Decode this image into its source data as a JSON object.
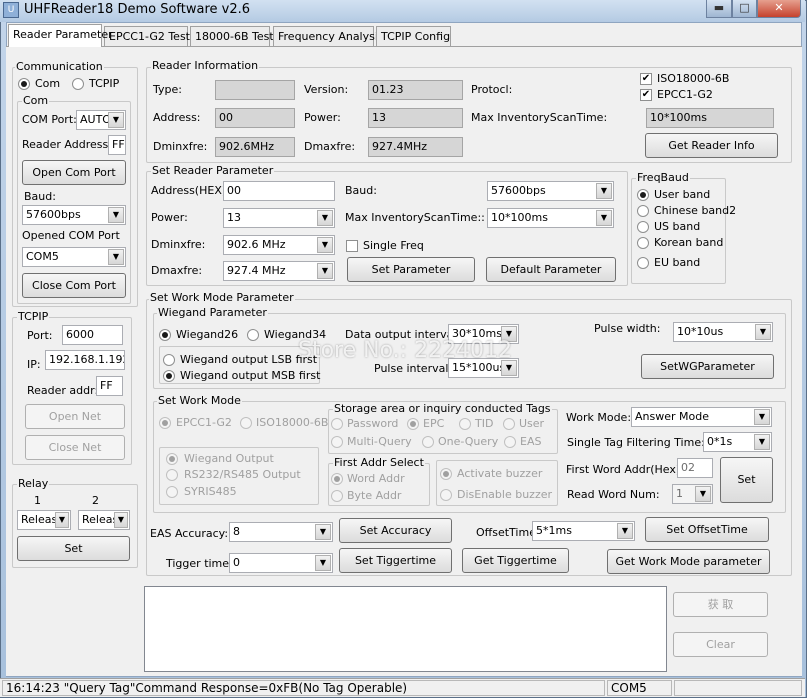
{
  "window": {
    "title": "UHFReader18 Demo Software v2.6",
    "app_icon": "U"
  },
  "tabs": [
    "Reader Parameter",
    "EPCC1-G2 Test",
    "18000-6B Test",
    "Frequency Analysis",
    "TCPIP Config"
  ],
  "communication": {
    "title": "Communication",
    "com_label": "Com",
    "tcpip_label": "TCPIP",
    "com_group": "Com",
    "com_port_label": "COM Port:",
    "com_port_value": "AUTO",
    "reader_address_label": "Reader Address:",
    "reader_address_value": "FF",
    "open_com_port": "Open Com Port",
    "baud_label": "Baud:",
    "baud_value": "57600bps",
    "opened_com_port_label": "Opened COM Port",
    "opened_com_port_value": "COM5",
    "close_com_port": "Close Com Port"
  },
  "tcpip": {
    "title": "TCPIP",
    "port_label": "Port:",
    "port_value": "6000",
    "ip_label": "IP:",
    "ip_value": "192.168.1.192",
    "reader_addr_label": "Reader addr:",
    "reader_addr_value": "FF",
    "open_net": "Open Net",
    "close_net": "Close Net"
  },
  "relay": {
    "title": "Relay",
    "col1": "1",
    "col2": "2",
    "value1": "Releas",
    "value2": "Releas",
    "set": "Set"
  },
  "reader_info": {
    "title": "Reader Information",
    "type_label": "Type:",
    "type_value": "",
    "version_label": "Version:",
    "version_value": "01.23",
    "protocol_label": "Protocl:",
    "iso_label": "ISO18000-6B",
    "epc_label": "EPCC1-G2",
    "address_label": "Address:",
    "address_value": "00",
    "power_label": "Power:",
    "power_value": "13",
    "max_inv_label": "Max InventoryScanTime:",
    "max_inv_value": "10*100ms",
    "dminfre_label": "Dminxfre:",
    "dminfre_value": "902.6MHz",
    "dmaxfre_label": "Dmaxfre:",
    "dmaxfre_value": "927.4MHz",
    "get_reader_info": "Get Reader Info"
  },
  "set_reader": {
    "title": "Set Reader Parameter",
    "address_label": "Address(HEX):",
    "address_value": "00",
    "baud_label": "Baud:",
    "baud_value": "57600bps",
    "power_label": "Power:",
    "power_value": "13",
    "max_inv_label": "Max InventoryScanTime::",
    "max_inv_value": "10*100ms",
    "dminfre_label": "Dminxfre:",
    "dminfre_value": "902.6 MHz",
    "single_freq_label": "Single Freq",
    "dmaxfre_label": "Dmaxfre:",
    "dmaxfre_value": "927.4 MHz",
    "set_parameter": "Set Parameter",
    "default_parameter": "Default Parameter"
  },
  "freqband": {
    "title": "FreqBaud",
    "options": [
      "User band",
      "Chinese band2",
      "US band",
      "Korean band",
      "EU band"
    ]
  },
  "work_mode_param": {
    "title": "Set Work Mode Parameter"
  },
  "wiegand": {
    "title": "Wiegand Parameter",
    "w26": "Wiegand26",
    "w34": "Wiegand34",
    "lsb": "Wiegand output LSB first",
    "msb": "Wiegand output MSB first",
    "data_interval_label": "Data output interval:",
    "data_interval_value": "30*10ms",
    "pulse_width_label": "Pulse width:",
    "pulse_width_value": "10*10us",
    "pulse_interval_label": "Pulse interval:",
    "pulse_interval_value": "15*100us",
    "set_wg": "SetWGParameter"
  },
  "watermark": "Store No.: 2224012",
  "set_work_mode": {
    "title": "Set Work Mode",
    "epc": "EPCC1-G2",
    "iso": "ISO18000-6B",
    "wiegand_output": "Wiegand Output",
    "rs232": "RS232/RS485 Output",
    "syris": "SYRIS485",
    "storage_title": "Storage area or inquiry conducted Tags",
    "password": "Password",
    "epc2": "EPC",
    "tid": "TID",
    "user": "User",
    "multi_query": "Multi-Query",
    "one_query": "One-Query",
    "eas": "EAS",
    "first_addr_title": "First Addr Select",
    "word_addr": "Word Addr",
    "byte_addr": "Byte Addr",
    "activate_buzzer": "Activate buzzer",
    "disable_buzzer": "DisEnable buzzer",
    "work_mode_label": "Work Mode:",
    "work_mode_value": "Answer Mode",
    "single_tag_label": "Single Tag Filtering Time:",
    "single_tag_value": "0*1s",
    "first_word_label": "First Word Addr(Hex):",
    "first_word_value": "02",
    "read_word_label": "Read Word Num:",
    "read_word_value": "1",
    "set": "Set"
  },
  "eas": {
    "accuracy_label": "EAS Accuracy:",
    "accuracy_value": "8",
    "set_accuracy": "Set Accuracy",
    "offset_label": "OffsetTime:",
    "offset_value": "5*1ms",
    "set_offset": "Set OffsetTime",
    "trigger_label": "Tigger time:",
    "trigger_value": "0",
    "set_trigger": "Set Tiggertime",
    "get_trigger": "Get Tiggertime",
    "get_work_mode": "Get Work Mode parameter"
  },
  "side_buttons": {
    "fetch": "获 取",
    "clear": "Clear"
  },
  "status": {
    "message": "16:14:23 \"Query Tag\"Command Response=0xFB(No Tag Operable)",
    "port": "COM5"
  }
}
